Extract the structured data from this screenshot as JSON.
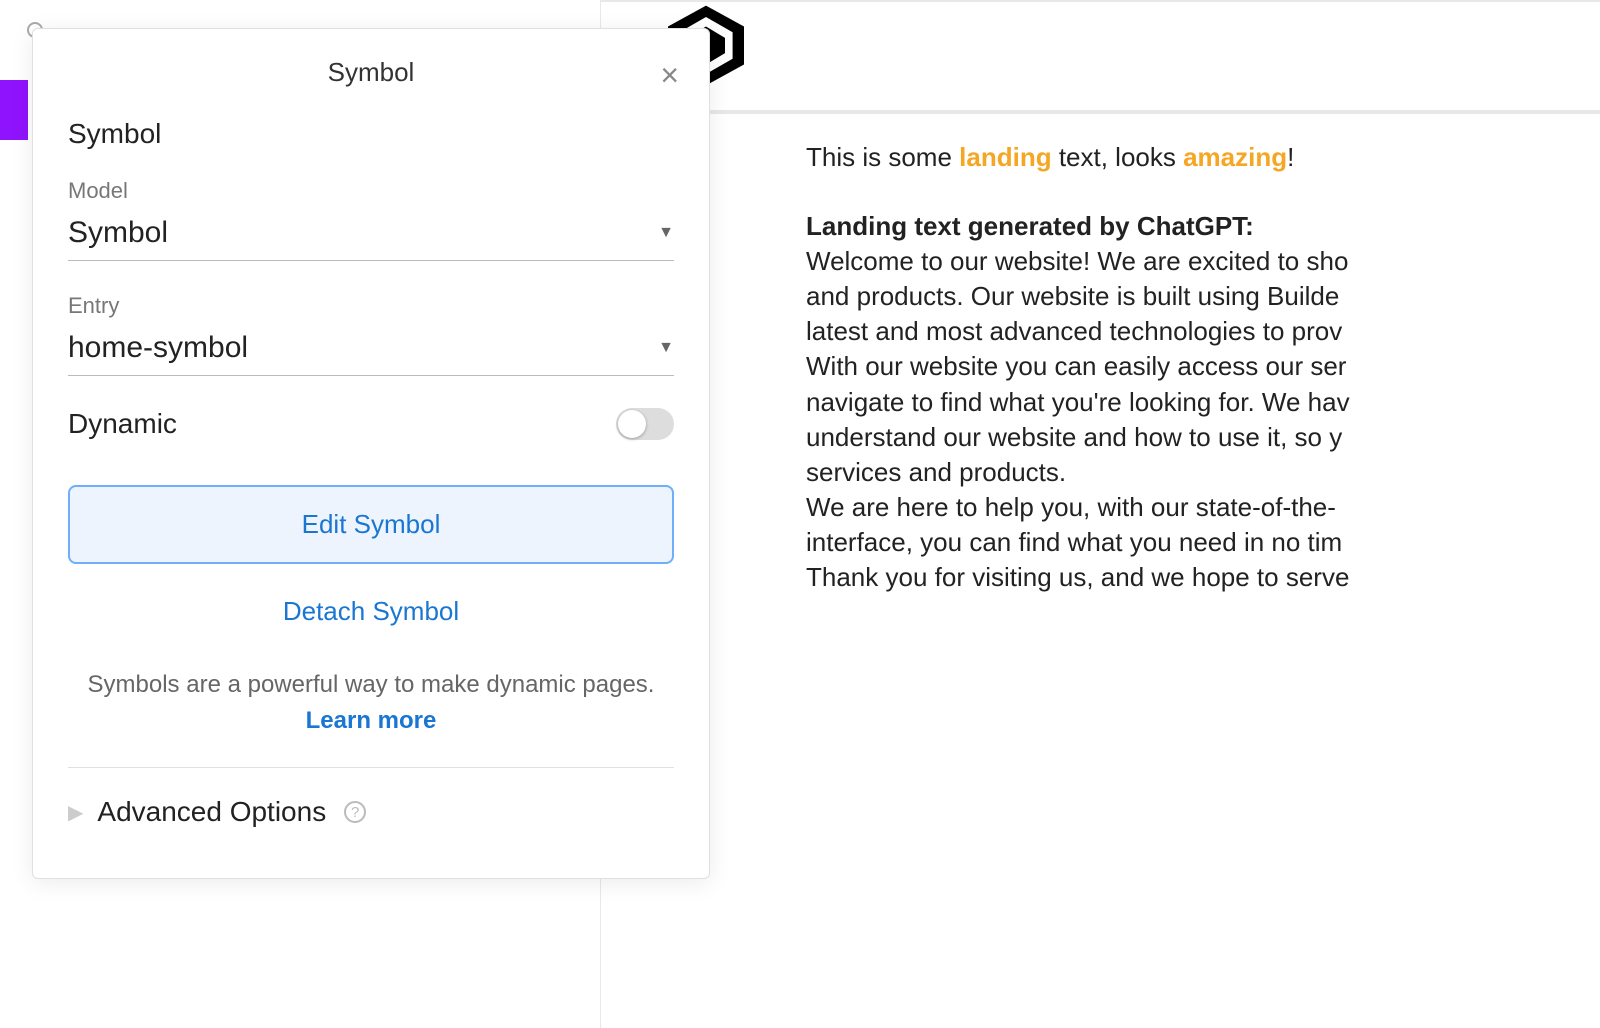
{
  "search": {
    "placeholder_visible": ""
  },
  "modal": {
    "title": "Symbol",
    "section_title": "Symbol",
    "model": {
      "label": "Model",
      "value": "Symbol"
    },
    "entry": {
      "label": "Entry",
      "value": "home-symbol"
    },
    "dynamic": {
      "label": "Dynamic",
      "enabled": false
    },
    "edit_button": "Edit Symbol",
    "detach_button": "Detach Symbol",
    "info_text": "Symbols are a powerful way to make dynamic pages.",
    "learn_more": "Learn more",
    "advanced_label": "Advanced Options"
  },
  "canvas": {
    "intro_prefix": "This is some ",
    "intro_highlight1": "landing",
    "intro_mid": " text, looks ",
    "intro_highlight2": "amazing",
    "intro_suffix": "!",
    "heading": "Landing text generated by ChatGPT:",
    "body_line1": "Welcome to our website! We are excited to sho",
    "body_line2": "and products. Our website is built using Builde",
    "body_line3": "latest and most advanced technologies to prov",
    "body_line4": "With our website you can easily access our ser",
    "body_line5": "navigate to find what you're looking for. We hav",
    "body_line6": "understand our website and how to use it, so y",
    "body_line7": "services and products.",
    "body_line8": "We are here to help you, with our state-of-the-",
    "body_line9": "interface, you can find what you need in no tim",
    "body_line10": "Thank you for visiting us, and we hope to serve"
  }
}
